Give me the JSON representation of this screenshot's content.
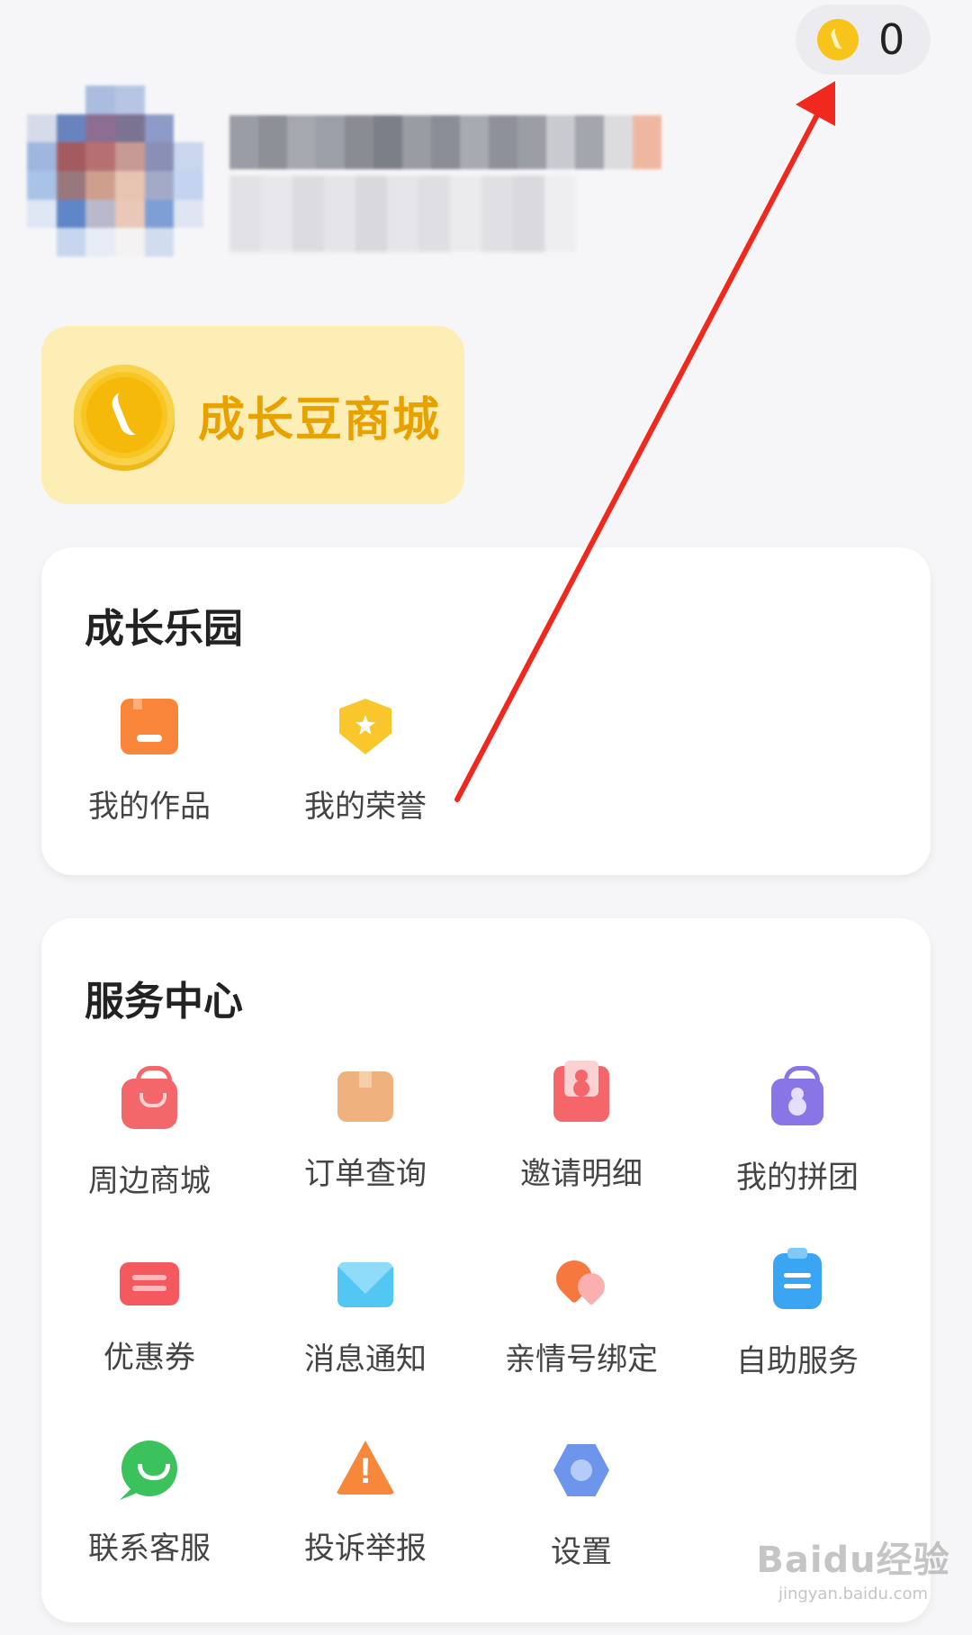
{
  "balance": {
    "icon": "coin-icon",
    "count": "0"
  },
  "mall_banner": {
    "icon": "coin-icon",
    "title": "成长豆商城",
    "accent_color": "#e8a200",
    "background_color": "#fdeeb6"
  },
  "growth_section": {
    "title": "成长乐园",
    "items": [
      {
        "label": "我的作品",
        "icon": "works-icon"
      },
      {
        "label": "我的荣誉",
        "icon": "honor-badge-icon"
      }
    ]
  },
  "service_section": {
    "title": "服务中心",
    "items": [
      {
        "label": "周边商城",
        "icon": "shopping-bag-icon"
      },
      {
        "label": "订单查询",
        "icon": "package-icon"
      },
      {
        "label": "邀请明细",
        "icon": "invite-envelope-icon"
      },
      {
        "label": "我的拼团",
        "icon": "group-buy-icon"
      },
      {
        "label": "优惠券",
        "icon": "coupon-icon"
      },
      {
        "label": "消息通知",
        "icon": "mail-icon"
      },
      {
        "label": "亲情号绑定",
        "icon": "hearts-icon"
      },
      {
        "label": "自助服务",
        "icon": "clipboard-icon"
      },
      {
        "label": "联系客服",
        "icon": "chat-icon"
      },
      {
        "label": "投诉举报",
        "icon": "warning-icon"
      },
      {
        "label": "设置",
        "icon": "settings-gear-icon"
      }
    ]
  },
  "annotation": {
    "arrow_color": "#f0281e"
  },
  "watermark": {
    "logo": "Baidu经验",
    "url": "jingyan.baidu.com"
  }
}
